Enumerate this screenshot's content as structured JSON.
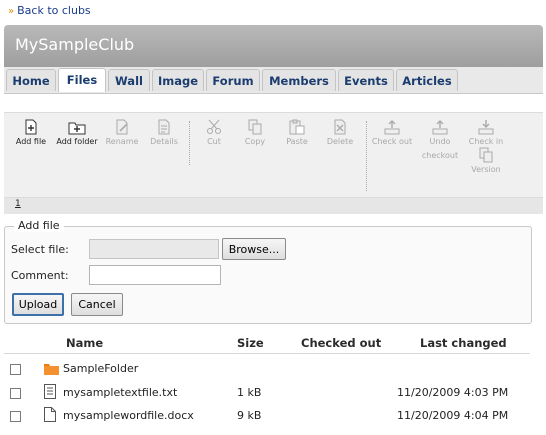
{
  "back_link": {
    "arrow": "»",
    "label": "Back to clubs"
  },
  "club": {
    "title": "MySampleClub"
  },
  "tabs": [
    "Home",
    "Files",
    "Wall",
    "Image",
    "Forum",
    "Members",
    "Events",
    "Articles"
  ],
  "active_tab": "Files",
  "toolbar": {
    "add_file": "Add file",
    "add_folder": "Add folder",
    "rename": "Rename",
    "details": "Details",
    "cut": "Cut",
    "copy": "Copy",
    "paste": "Paste",
    "delete": "Delete",
    "check_out": "Check out",
    "undo_checkout_1": "Undo",
    "undo_checkout_2": "checkout",
    "check_in_1": "Check in",
    "version": "Version"
  },
  "pager": {
    "page": "1"
  },
  "add_file_form": {
    "legend": "Add file",
    "select_file_label": "Select file:",
    "browse_label": "Browse...",
    "comment_label": "Comment:",
    "upload_label": "Upload",
    "cancel_label": "Cancel"
  },
  "grid": {
    "headers": {
      "name": "Name",
      "size": "Size",
      "checked_out": "Checked out",
      "last_changed": "Last changed"
    },
    "rows": [
      {
        "icon": "folder-icon",
        "name": "SampleFolder",
        "size": "",
        "checked_out": "",
        "last_changed": ""
      },
      {
        "icon": "text-file-icon",
        "name": "mysampletextfile.txt",
        "size": "1 kB",
        "checked_out": "",
        "last_changed": "11/20/2009 4:03 PM"
      },
      {
        "icon": "word-file-icon",
        "name": "mysamplewordfile.docx",
        "size": "9 kB",
        "checked_out": "",
        "last_changed": "11/20/2009 4:04 PM"
      }
    ]
  },
  "colors": {
    "link": "#1a3c8a",
    "tab_text": "#1a3c6e",
    "header_gray": "#a8a8a8",
    "folder_orange": "#f07b12"
  }
}
